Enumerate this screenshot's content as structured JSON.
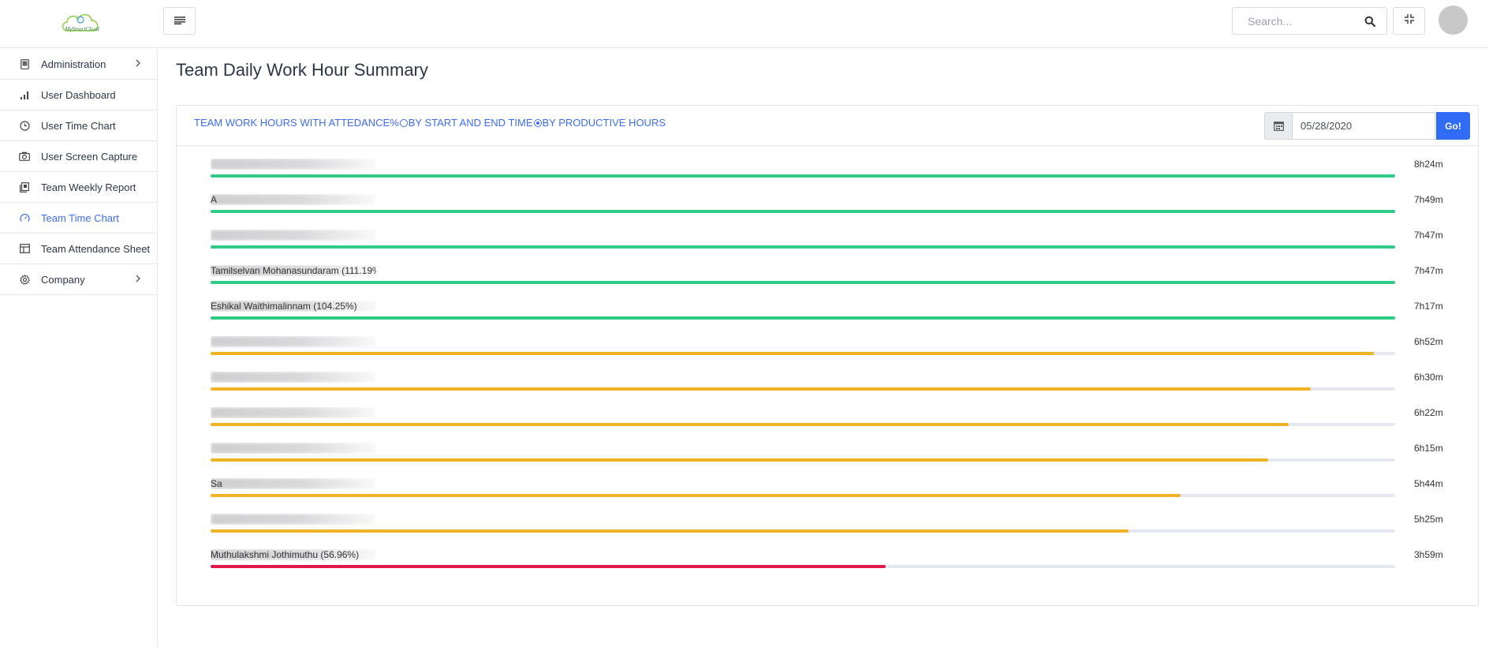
{
  "header": {
    "logo_text": "MySmartCloud",
    "search_placeholder": "Search...",
    "menu_icon": "hamburger-icon",
    "fullscreen_icon": "compress-icon"
  },
  "sidebar": {
    "items": [
      {
        "label": "Administration",
        "icon": "tablet-icon",
        "has_chevron": true
      },
      {
        "label": "User Dashboard",
        "icon": "bar-chart-icon"
      },
      {
        "label": "User Time Chart",
        "icon": "clock-icon"
      },
      {
        "label": "User Screen Capture",
        "icon": "camera-icon"
      },
      {
        "label": "Team Weekly Report",
        "icon": "report-icon"
      },
      {
        "label": "Team Time Chart",
        "icon": "gauge-icon",
        "active": true
      },
      {
        "label": "Team Attendance Sheet",
        "icon": "table-icon"
      },
      {
        "label": "Company",
        "icon": "gear-icon",
        "has_chevron": true
      }
    ]
  },
  "page": {
    "title": "Team Daily Work Hour Summary"
  },
  "toolbar": {
    "tabs": [
      {
        "label": "TEAM WORK HOURS WITH ATTEDANCE%",
        "selected": false
      },
      {
        "label": "BY START AND END TIME",
        "selected": true
      },
      {
        "label": "BY PRODUCTIVE HOURS",
        "selected": false
      }
    ],
    "date_value": "05/28/2020",
    "go_label": "Go!"
  },
  "colors": {
    "accent": "#3d6cf0",
    "green": "#2ecc87",
    "amber": "#f0b323",
    "red": "#e0194a",
    "track": "#e5e8f0"
  },
  "rows": [
    {
      "name": "",
      "hours": "8h24m",
      "fraction": 1.0,
      "status": "green"
    },
    {
      "name": "A",
      "hours": "7h49m",
      "fraction": 1.0,
      "status": "green"
    },
    {
      "name": "",
      "hours": "7h47m",
      "fraction": 1.0,
      "status": "green"
    },
    {
      "name": "Tamilselvan Mohanasundaram (111.19%)",
      "hours": "7h47m",
      "fraction": 1.0,
      "status": "green"
    },
    {
      "name": "Eshikal Waithimalinnam (104.25%)",
      "hours": "7h17m",
      "fraction": 1.0,
      "status": "green"
    },
    {
      "name": "",
      "hours": "6h52m",
      "fraction": 0.982,
      "status": "amber"
    },
    {
      "name": "",
      "hours": "6h30m",
      "fraction": 0.929,
      "status": "amber"
    },
    {
      "name": "",
      "hours": "6h22m",
      "fraction": 0.91,
      "status": "amber"
    },
    {
      "name": "",
      "hours": "6h15m",
      "fraction": 0.893,
      "status": "amber"
    },
    {
      "name": "Sa",
      "hours": "5h44m",
      "fraction": 0.819,
      "status": "amber"
    },
    {
      "name": "",
      "hours": "5h25m",
      "fraction": 0.775,
      "status": "amber"
    },
    {
      "name": "Muthulakshmi Jothimuthu (56.96%)",
      "hours": "3h59m",
      "fraction": 0.57,
      "status": "red"
    }
  ]
}
